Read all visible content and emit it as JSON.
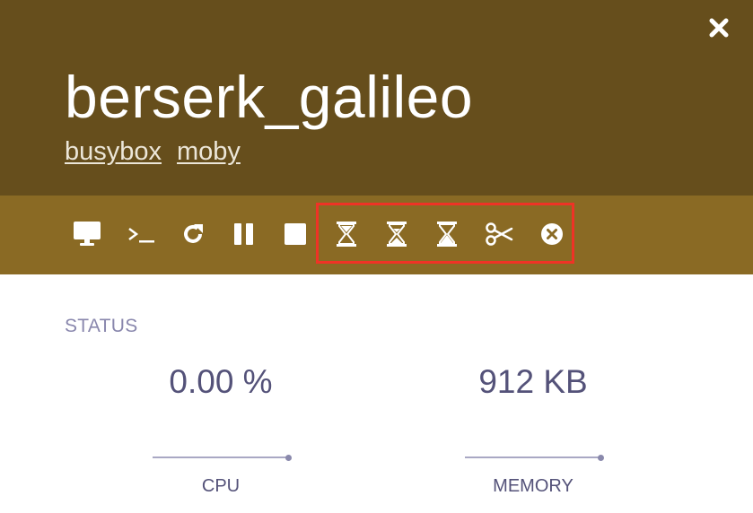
{
  "container": {
    "name": "berserk_galileo",
    "tags": [
      "busybox",
      "moby"
    ]
  },
  "toolbar": {
    "actions": [
      {
        "name": "preview",
        "icon": "monitor-icon"
      },
      {
        "name": "console",
        "icon": "terminal-icon"
      },
      {
        "name": "restart",
        "icon": "refresh-icon"
      },
      {
        "name": "pause",
        "icon": "pause-icon"
      },
      {
        "name": "stop",
        "icon": "stop-icon"
      },
      {
        "name": "hourglass-start",
        "icon": "hourglass-start-icon"
      },
      {
        "name": "hourglass-half",
        "icon": "hourglass-half-icon"
      },
      {
        "name": "hourglass-end",
        "icon": "hourglass-end-icon"
      },
      {
        "name": "cut",
        "icon": "scissors-icon"
      },
      {
        "name": "remove",
        "icon": "times-circle-icon"
      }
    ]
  },
  "status": {
    "label": "STATUS",
    "cpu": {
      "value": "0.00 %",
      "label": "CPU"
    },
    "memory": {
      "value": "912 KB",
      "label": "MEMORY"
    }
  },
  "colors": {
    "header_bg": "#664e1c",
    "toolbar_bg": "#8a6a24",
    "highlight": "#ef3326",
    "metric_text": "#545279",
    "label_text": "#8987ad"
  }
}
